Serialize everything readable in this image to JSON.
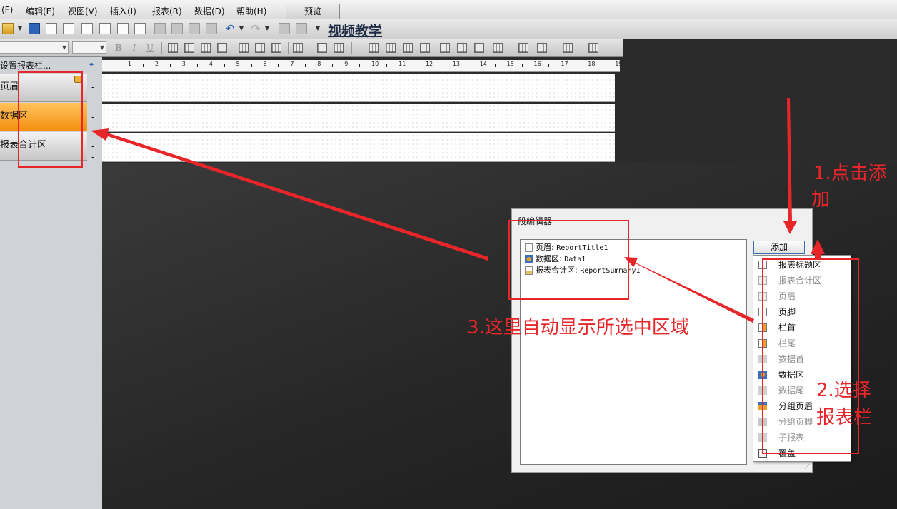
{
  "menu": {
    "items": [
      "(F)",
      "编辑(E)",
      "视图(V)",
      "插入(I)",
      "报表(R)",
      "数据(D)",
      "帮助(H)"
    ],
    "preview_tab": "预览"
  },
  "toolbar": {
    "title_link": "视频教学"
  },
  "format_toolbar": {
    "bold": "B",
    "italic": "I",
    "underline": "U"
  },
  "left_panel": {
    "header": "设置报表栏...",
    "bands": [
      {
        "label": "页眉",
        "selected": false
      },
      {
        "label": "数据区",
        "selected": true
      },
      {
        "label": "报表合计区",
        "selected": false
      }
    ],
    "dash": "-"
  },
  "ruler": {
    "numbers": [
      "1",
      "2",
      "3",
      "4",
      "5",
      "6",
      "7",
      "8",
      "9",
      "10",
      "11",
      "12",
      "13",
      "14",
      "15",
      "16",
      "17",
      "18",
      "19"
    ]
  },
  "dialog": {
    "title": "段编辑器",
    "tree": [
      {
        "label": "页眉: ",
        "value": "ReportTitle1"
      },
      {
        "label": "数据区: ",
        "value": "Data1"
      },
      {
        "label": "报表合计区: ",
        "value": "ReportSummary1"
      }
    ],
    "add_button": "添加",
    "grip": "⋰"
  },
  "dropdown": {
    "items": [
      {
        "label": "报表标题区",
        "enabled": true
      },
      {
        "label": "报表合计区",
        "enabled": false
      },
      {
        "label": "页眉",
        "enabled": false
      },
      {
        "label": "页脚",
        "enabled": true
      },
      {
        "label": "栏首",
        "enabled": true
      },
      {
        "label": "栏尾",
        "enabled": false
      },
      {
        "label": "数据首",
        "enabled": false
      },
      {
        "label": "数据区",
        "enabled": true
      },
      {
        "label": "数据尾",
        "enabled": false
      },
      {
        "label": "分组页眉",
        "enabled": true
      },
      {
        "label": "分组页脚",
        "enabled": false
      },
      {
        "label": "子报表",
        "enabled": false
      },
      {
        "label": "覆盖",
        "enabled": true
      }
    ]
  },
  "annotations": {
    "step1_line1": "1.点击添",
    "step1_line2": "加",
    "step2_line1": "2.选择",
    "step2_line2": "报表栏",
    "step3": "3.这里自动显示所选中区域",
    "color": "#e8262a"
  },
  "colors": {
    "selected_band": "#f58f10",
    "canvas_bg": "#2b2b2b",
    "accent_blue": "#3c6fb4"
  }
}
